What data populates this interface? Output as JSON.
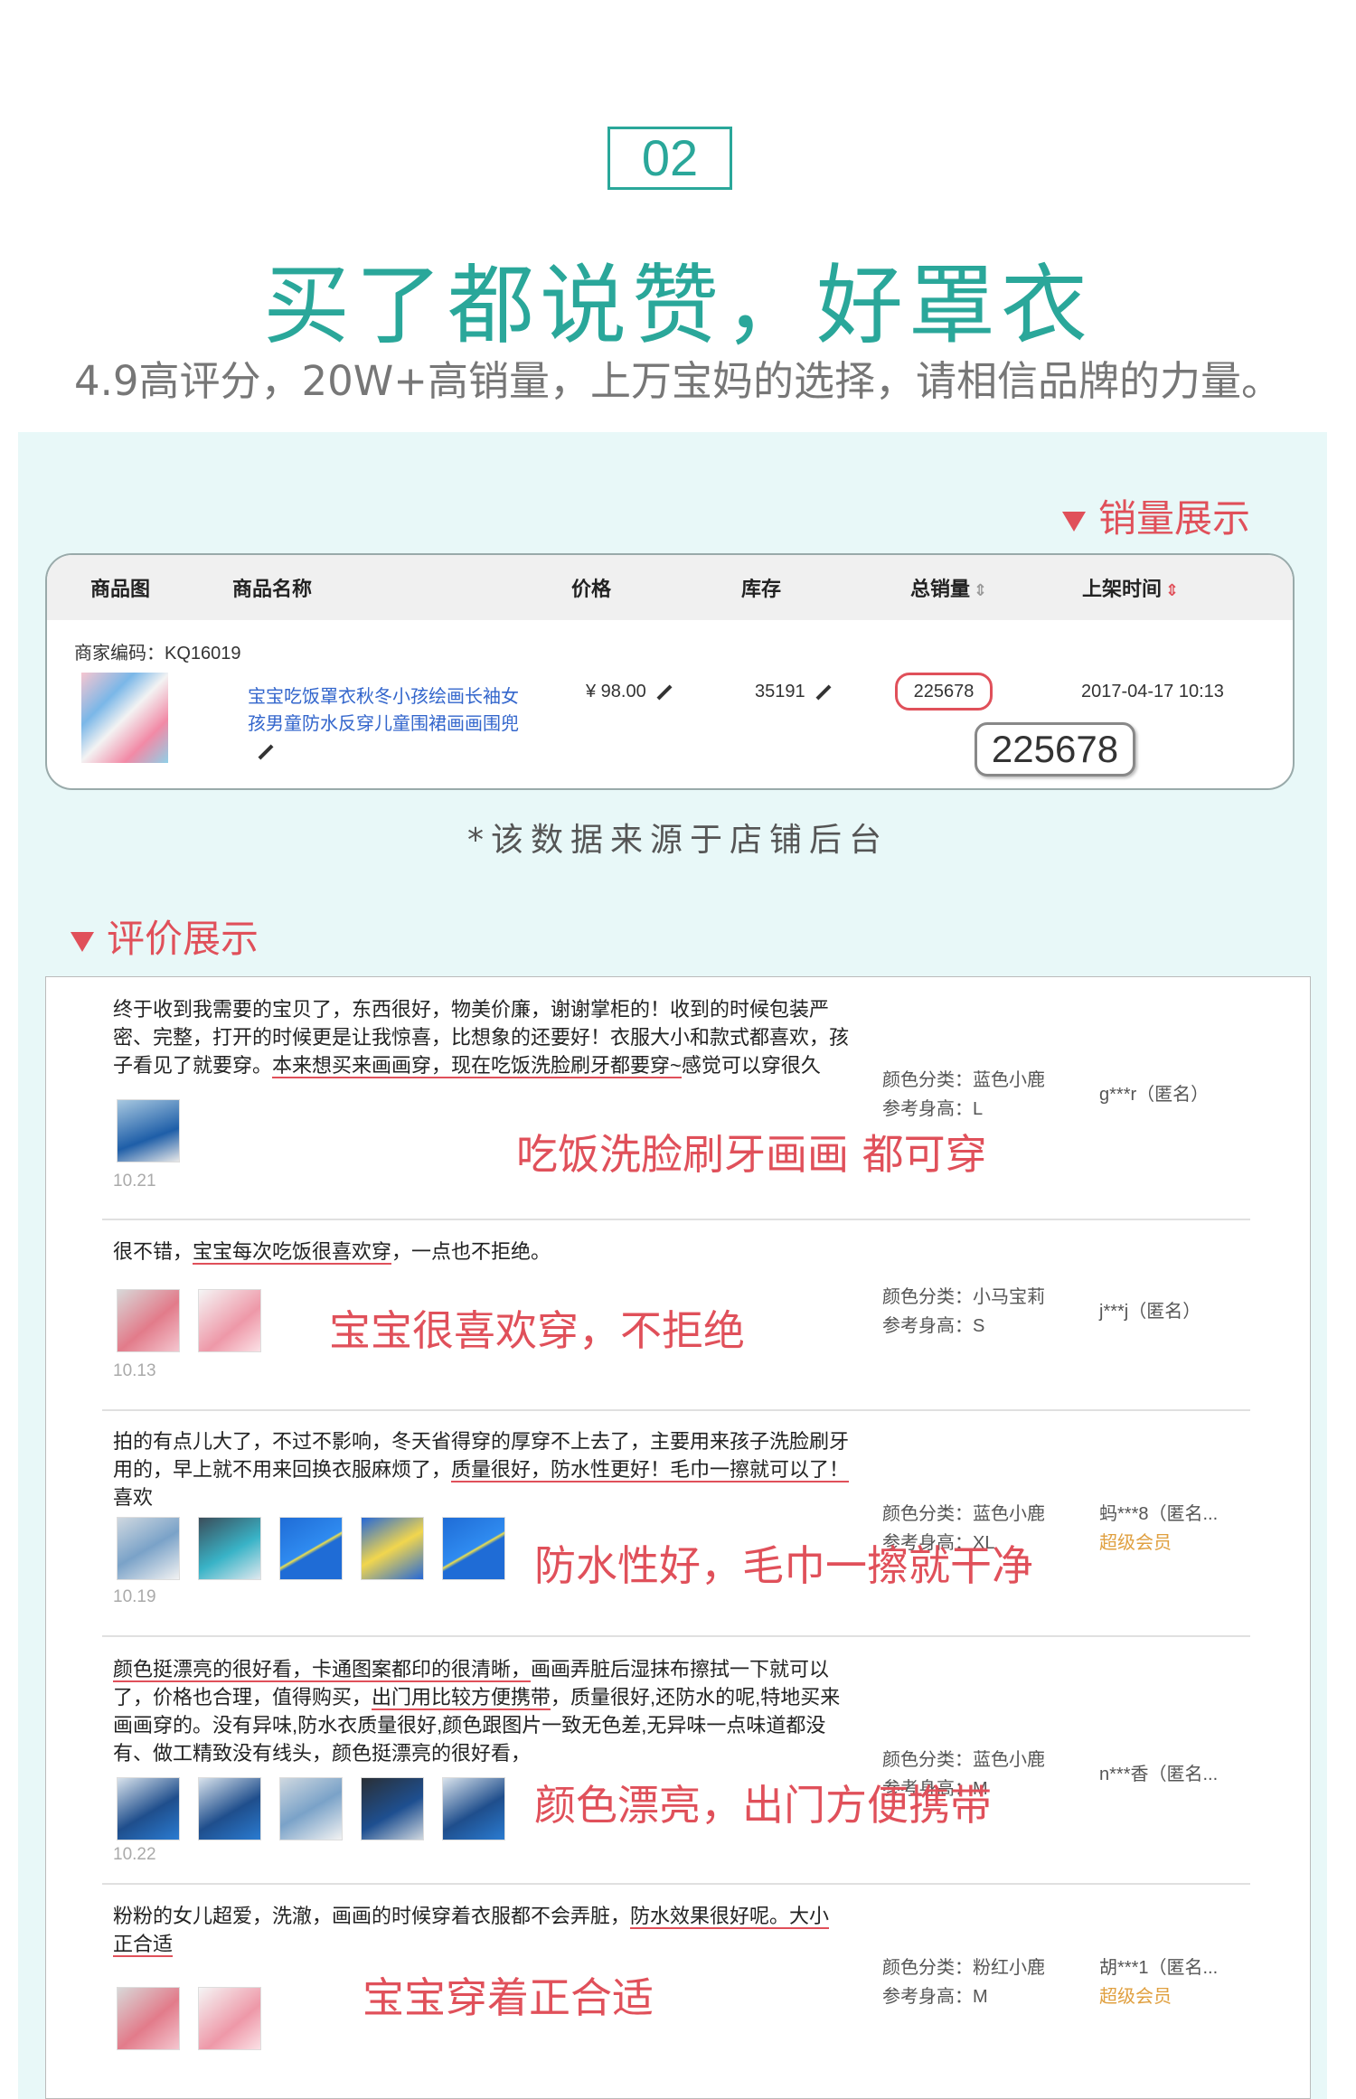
{
  "header": {
    "badge": "02",
    "title": "买了都说赞，好罩衣",
    "subtitle": "4.9高评分，20W+高销量，上万宝妈的选择，请相信品牌的力量。"
  },
  "sales_section": {
    "heading": "销量展示",
    "columns": [
      "商品图",
      "商品名称",
      "价格",
      "库存",
      "总销量",
      "上架时间"
    ],
    "merchant_code": "商家编码：KQ16019",
    "product_name_line1": "宝宝吃饭罩衣秋冬小孩绘画长袖女",
    "product_name_line2": "孩男童防水反穿儿童围裙画画围兜",
    "price": "¥ 98.00",
    "stock": "35191",
    "total_sales": "225678",
    "list_time": "2017-04-17 10:13",
    "sales_zoom": "225678",
    "source_note": "*该数据来源于店铺后台"
  },
  "reviews_section": {
    "heading": "评价展示",
    "reviews": [
      {
        "text_a": "终于收到我需要的宝贝了，东西很好，物美价廉，谢谢掌柜的！收到的时候包装严密、完整，打开的时候更是让我惊喜，比想象的还要好！衣服大小和款式都喜欢，孩子看见了就要穿。",
        "text_u": "本来想买来画画穿，现在吃饭洗脸刷牙都要穿~",
        "text_b": "感觉可以穿很久",
        "date": "10.21",
        "color_cat": "颜色分类：蓝色小鹿",
        "height": "参考身高：L",
        "user": "g***r（匿名）",
        "callout": "吃饭洗脸刷牙画画 都可穿"
      },
      {
        "text_a": "很不错，",
        "text_u": "宝宝每次吃饭很喜欢穿",
        "text_b": "，一点也不拒绝。",
        "date": "10.13",
        "color_cat": "颜色分类：小马宝莉",
        "height": "参考身高：S",
        "user": "j***j（匿名）",
        "callout": "宝宝很喜欢穿，不拒绝"
      },
      {
        "text_a": "拍的有点儿大了，不过不影响，冬天省得穿的厚穿不上去了，主要用来孩子洗脸刷牙用的，早上就不用来回换衣服麻烦了，",
        "text_u": "质量很好，防水性更好！毛巾一擦就可以了！",
        "text_b": "喜欢",
        "date": "10.19",
        "color_cat": "颜色分类：蓝色小鹿",
        "height": "参考身高：XL",
        "user": "蚂***8（匿名...",
        "vip": "超级会员",
        "callout": "防水性好，毛巾一擦就干净"
      },
      {
        "text_u1": "颜色挺漂亮的很好看，卡通图案都印的很清晰，",
        "text_a": "画画弄脏后湿抹布擦拭一下就可以了，价格也合理，值得购买，",
        "text_u2": "出门用比较方便携带",
        "text_b": "，质量很好,还防水的呢,特地买来画画穿的。没有异味,防水衣质量很好,颜色跟图片一致无色差,无异味一点味道都没有、做工精致没有线头，颜色挺漂亮的很好看，",
        "date": "10.22",
        "color_cat": "颜色分类：蓝色小鹿",
        "height": "参考身高：M",
        "user": "n***香（匿名...",
        "callout": "颜色漂亮，出门方便携带"
      },
      {
        "text_a": "粉粉的女儿超爱，洗澈，画画的时候穿着衣服都不会弄脏，",
        "text_u": "防水效果很好呢。大小正合适",
        "color_cat": "颜色分类：粉红小鹿",
        "height": "参考身高：M",
        "user": "胡***1（匿名...",
        "vip": "超级会员",
        "callout": "宝宝穿着正合适"
      }
    ]
  },
  "colors": {
    "teal": "#2aa79a",
    "accent_red": "#e0505a",
    "panel_bg": "#e8f8f8"
  },
  "icons": [
    "triangle-down-icon",
    "pencil-icon",
    "sort-icon"
  ]
}
